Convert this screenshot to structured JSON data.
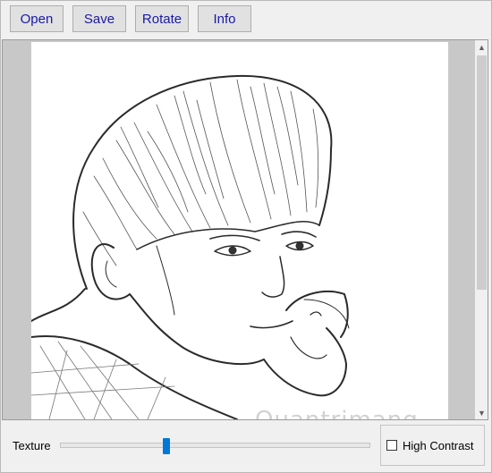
{
  "toolbar": {
    "open_label": "Open",
    "save_label": "Save",
    "rotate_label": "Rotate",
    "info_label": "Info"
  },
  "image": {
    "description_icon": "pencil-sketch-portrait",
    "watermark": "Quantrimang"
  },
  "scrollbar": {
    "up_icon": "arrow-up-icon",
    "down_icon": "arrow-down-icon"
  },
  "controls": {
    "texture_label": "Texture",
    "texture_value": 0.34,
    "high_contrast_label": "High Contrast",
    "high_contrast_checked": false
  },
  "colors": {
    "accent": "#0078d7",
    "button_text": "#1a1aa6"
  }
}
